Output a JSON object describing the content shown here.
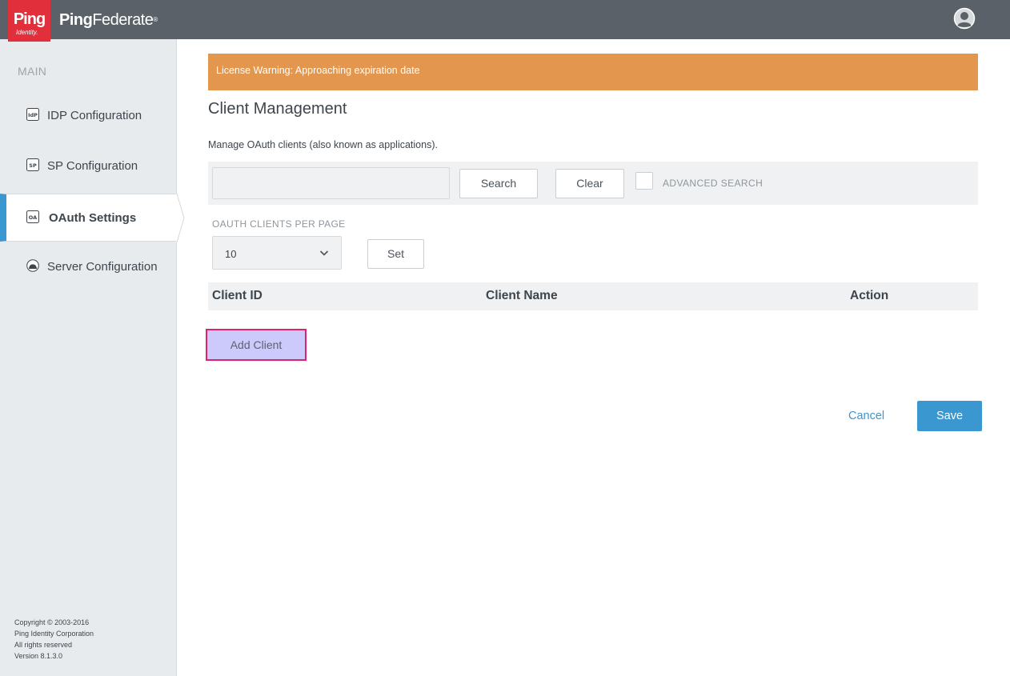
{
  "header": {
    "logo_text": "Ping",
    "logo_subtext": "Identity.",
    "product_name_bold": "Ping",
    "product_name_rest": "Federate",
    "product_mark": "®",
    "user_icon": "user-avatar-icon"
  },
  "sidebar": {
    "heading": "MAIN",
    "items": [
      {
        "label": "IDP Configuration",
        "icon": "idp-icon",
        "icon_text": "IdP"
      },
      {
        "label": "SP Configuration",
        "icon": "sp-icon",
        "icon_text": "SP"
      },
      {
        "label": "OAuth Settings",
        "icon": "oauth-icon",
        "icon_text": "OA",
        "active": true
      },
      {
        "label": "Server Configuration",
        "icon": "server-icon"
      }
    ],
    "copyright": [
      "Copyright © 2003-2016",
      "Ping Identity Corporation",
      "All rights reserved",
      "Version 8.1.3.0"
    ]
  },
  "main": {
    "banner": "License Warning: Approaching expiration date",
    "title": "Client Management",
    "description": "Manage OAuth clients (also known as applications).",
    "search": {
      "value": "",
      "placeholder": "",
      "search_label": "Search",
      "clear_label": "Clear",
      "advanced_label": "ADVANCED SEARCH",
      "advanced_checked": false
    },
    "per_page": {
      "label": "OAUTH CLIENTS PER PAGE",
      "value": "10",
      "set_label": "Set"
    },
    "table": {
      "columns": [
        "Client ID",
        "Client Name",
        "Action"
      ],
      "rows": []
    },
    "add_client_label": "Add Client",
    "cancel_label": "Cancel",
    "save_label": "Save"
  },
  "colors": {
    "topbar": "#5b6168",
    "brand_red": "#e12f3c",
    "banner": "#e2964e",
    "accent": "#3b97cf",
    "highlight_border": "#e0226e",
    "highlight_fill": "#ccc9fb"
  }
}
